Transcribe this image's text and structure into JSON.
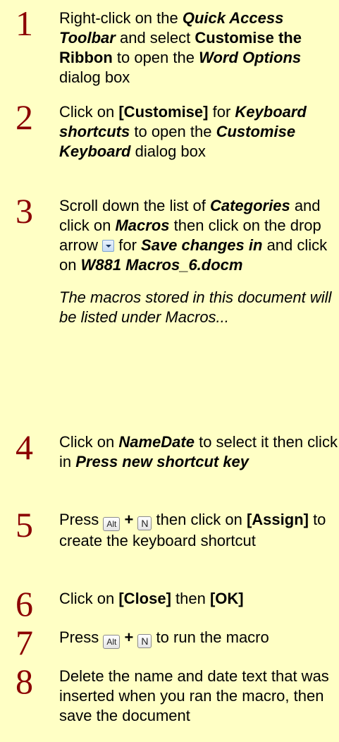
{
  "steps": [
    {
      "number": "1",
      "t1": "Right-click on the ",
      "t2": "Quick Access Toolbar",
      "t3": " and select ",
      "t4": "Customise the Ribbon",
      "t5": " to open the ",
      "t6": "Word Options",
      "t7": " dialog box"
    },
    {
      "number": "2",
      "t1": "Click on ",
      "t2": "[Customise]",
      "t3": " for ",
      "t4": "Keyboard shortcuts",
      "t5": " to open the ",
      "t6": "Customise Keyboard",
      "t7": " dialog box"
    },
    {
      "number": "3",
      "t1": "Scroll down the list of ",
      "t2": "Categories",
      "t3": " and click on ",
      "t4": "Macros",
      "t5": " then click on the drop arrow ",
      "t6": " for ",
      "t7": "Save changes in",
      "t8": " and click on ",
      "t9": "W881 Macros_6.docm",
      "note": "The macros stored in this document will be listed under Macros..."
    },
    {
      "number": "4",
      "t1": "Click on ",
      "t2": "NameDate",
      "t3": " to select it then click in ",
      "t4": "Press new shortcut key"
    },
    {
      "number": "5",
      "t1": "Press ",
      "key1": "Alt",
      "plus": " + ",
      "key2": "N",
      "t2": " then click on ",
      "t3": "[Assign]",
      "t4": " to create the keyboard shortcut"
    },
    {
      "number": "6",
      "t1": "Click on ",
      "t2": "[Close]",
      "t3": " then ",
      "t4": "[OK]"
    },
    {
      "number": "7",
      "t1": "Press ",
      "key1": "Alt",
      "plus": " + ",
      "key2": "N",
      "t2": " to run the macro"
    },
    {
      "number": "8",
      "t1": "Delete the name and date text that was inserted when you ran the macro, then save the document"
    }
  ]
}
